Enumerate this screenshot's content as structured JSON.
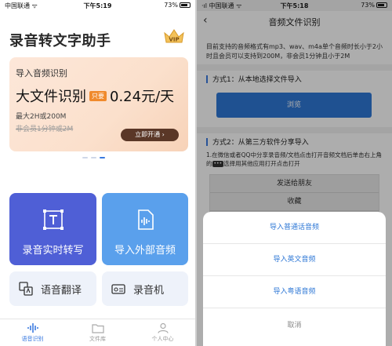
{
  "left": {
    "status": {
      "carrier": "中国联通",
      "time": "下午5:19",
      "battery": "73%"
    },
    "app_title": "录音转文字助手",
    "vip_label": "VIP",
    "banner": {
      "subtitle": "导入音频识别",
      "main_text": "大文件识别",
      "tag": "只要",
      "price": "0.24元/天",
      "max_text": "最大2H或200M",
      "old_text": "非会员1分钟或2M",
      "button": "立即开通 ›"
    },
    "tiles": {
      "record": "录音实时转写",
      "import": "导入外部音频",
      "translate": "语音翻译",
      "recorder": "录音机"
    },
    "tabs": [
      {
        "label": "语音识别",
        "active": true
      },
      {
        "label": "文件库",
        "active": false
      },
      {
        "label": "个人中心",
        "active": false
      }
    ]
  },
  "right": {
    "status": {
      "carrier": "中国联通",
      "time": "下午5:18",
      "battery": "73%"
    },
    "title": "音频文件识别",
    "info": "目前支持的音频格式有mp3、wav、m4a单个音频时长小于2小时且会员可以支持到200M，非会员1分钟且小于2M",
    "section1": "方式1：从本地选择文件导入",
    "browse_button": "浏览",
    "section2": "方式2：从第三方软件分享导入",
    "info2_prefix": "1.在微信或者QQ中分享录音频/文档点击打开音频文档后单击右上角的",
    "info2_key": "•••",
    "info2_suffix": "选择用其他应用打开点击打开",
    "share_items": [
      "发送给朋友",
      "收藏",
      ""
    ],
    "sheet_items": [
      "导入普通话音频",
      "导入英文音频",
      "导入粤语音频"
    ],
    "sheet_cancel": "取消"
  },
  "colors": {
    "accent": "#2f78d6",
    "tile_record": "#4f5fd6",
    "tile_import": "#5aa0ec",
    "banner_button": "#5a3727"
  }
}
